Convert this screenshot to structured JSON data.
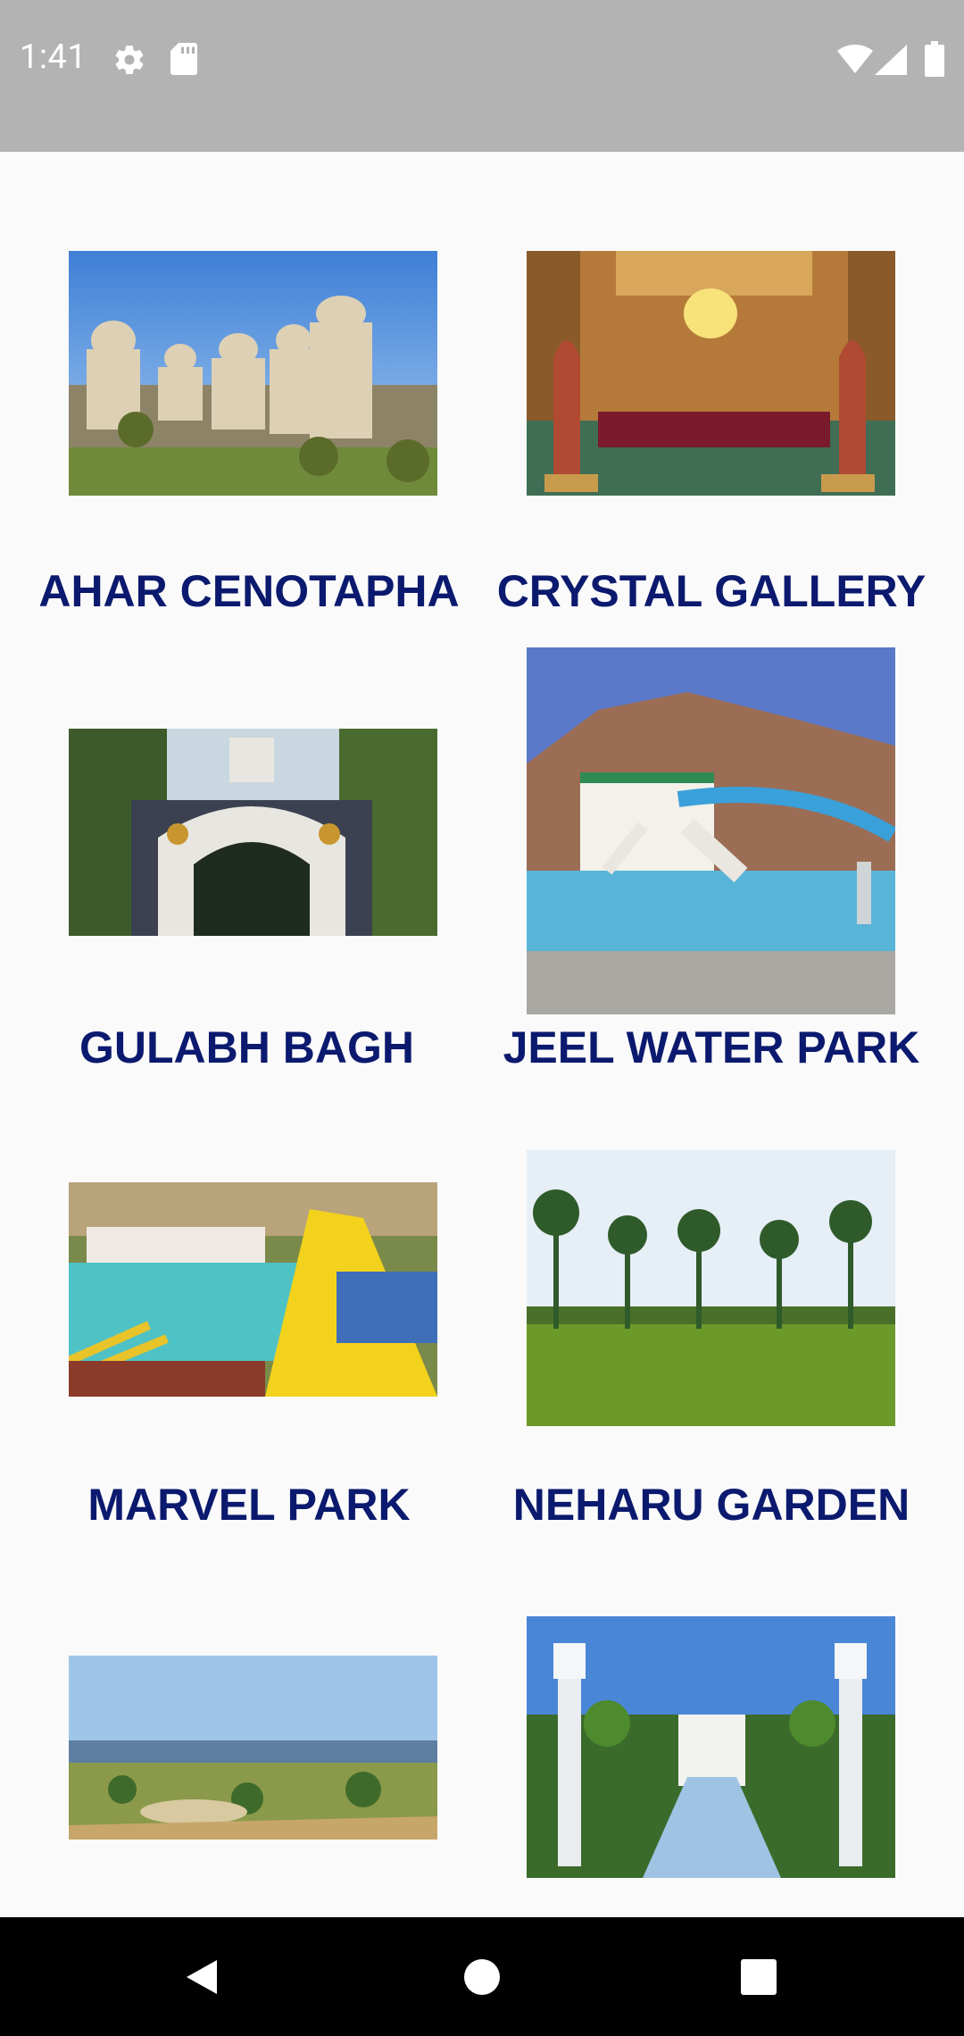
{
  "status_bar": {
    "time": "1:41",
    "icons": [
      "settings-icon",
      "sd-card-icon",
      "wifi-icon",
      "cell-signal-icon",
      "battery-icon"
    ],
    "background": "#b3b3b3"
  },
  "grid": {
    "items": [
      {
        "label": "AHAR CENOTAPHA",
        "image": "cenotaph-photo"
      },
      {
        "label": "CRYSTAL GALLERY",
        "image": "crystal-gallery-photo"
      },
      {
        "label": "GULABH BAGH",
        "image": "gulab-bagh-gate-photo"
      },
      {
        "label": "JEEL WATER PARK",
        "image": "water-park-slides-photo"
      },
      {
        "label": "MARVEL PARK",
        "image": "marvel-park-pool-photo"
      },
      {
        "label": "NEHARU GARDEN",
        "image": "nehru-garden-lawn-photo"
      },
      {
        "label": "",
        "image": "lakeside-park-photo"
      },
      {
        "label": "",
        "image": "fountain-garden-photo"
      }
    ],
    "label_color": "#0b1a6e"
  },
  "nav_bar": {
    "buttons": [
      "back-icon",
      "home-icon",
      "recents-icon"
    ]
  }
}
